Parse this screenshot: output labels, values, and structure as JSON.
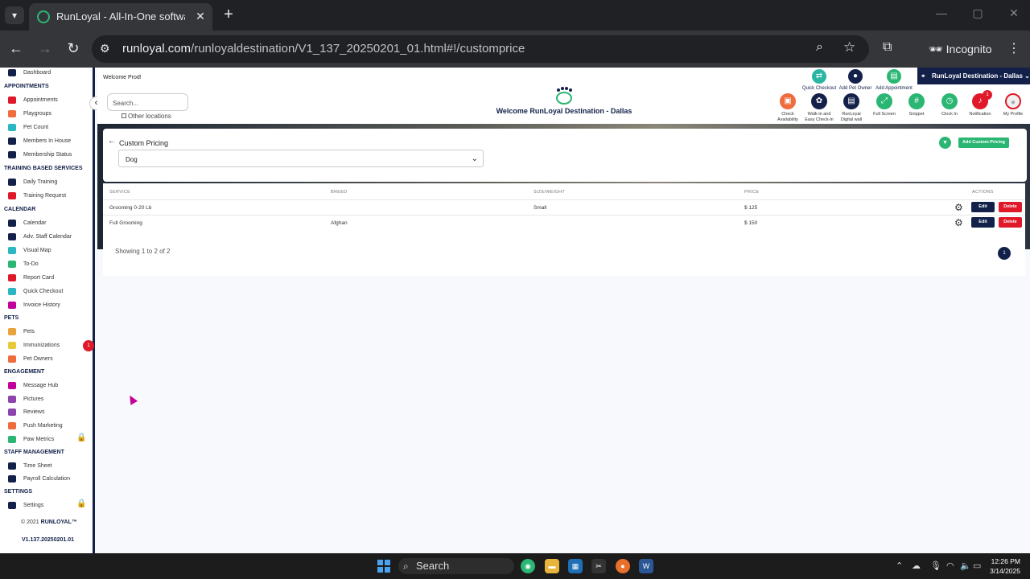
{
  "browser": {
    "tab_title": "RunLoyal - All-In-One software",
    "tab_close": "✕",
    "new_tab": "+",
    "url_host": "runloyal.com",
    "url_path": "/runloyaldestination/V1_137_20250201_01.html#!/customprice",
    "incognito_label": "Incognito"
  },
  "sidebar": {
    "top_item": "Dashboard",
    "sections": {
      "appointments": "APPOINTMENTS",
      "training": "TRAINING BASED SERVICES",
      "calendar": "CALENDAR",
      "pets": "PETS",
      "engagement": "ENGAGEMENT",
      "staff": "STAFF MANAGEMENT",
      "settings": "SETTINGS"
    },
    "items": {
      "appointments": "Appointments",
      "playgroups": "Playgroups",
      "pet_count": "Pet Count",
      "members_in_house": "Members In House",
      "membership_status": "Membership Status",
      "daily_training": "Daily Training",
      "training_request": "Training Request",
      "calendar": "Calendar",
      "adv_staff_calendar": "Adv. Staff Calendar",
      "visual_map": "Visual Map",
      "todo": "To-Do",
      "report_card": "Report Card",
      "quick_checkout": "Quick Checkout",
      "invoice_history": "Invoice History",
      "pets": "Pets",
      "immunizations": "Immunizations",
      "pet_owners": "Pet Owners",
      "message_hub": "Message Hub",
      "pictures": "Pictures",
      "reviews": "Reviews",
      "push_marketing": "Push Marketing",
      "paw_metrics": "Paw Metrics",
      "time_sheet": "Time Sheet",
      "payroll_calculation": "Payroll Calculation",
      "settings": "Settings"
    },
    "immunizations_badge": "1",
    "copyright_year": "© 2021",
    "copyright_brand": "RUNLOYAL™",
    "version": "V1.137.20250201.01"
  },
  "header": {
    "welcome_user": "Welcome Prod!",
    "search_placeholder": "Search...",
    "other_locations": "Other locations",
    "center_title": "Welcome RunLoyal Destination - Dallas",
    "quick_actions": [
      "Quick Checkout",
      "Add Pet Owner",
      "Add Appointment"
    ],
    "location": "RunLoyal Destination - Dallas",
    "toolbar": [
      {
        "label1": "Check",
        "label2": "Availability",
        "color": "#ef6c3e",
        "glyph": "▣"
      },
      {
        "label1": "Walk-in and",
        "label2": "Easy Check-in",
        "color": "#13214a",
        "glyph": "✿"
      },
      {
        "label1": "RunLoyal",
        "label2": "Digital wall",
        "color": "#13214a",
        "glyph": "▤"
      },
      {
        "label1": "Full Screen",
        "label2": "",
        "color": "#2bb673",
        "glyph": "⤢"
      },
      {
        "label1": "Snippet",
        "label2": "",
        "color": "#2bb673",
        "glyph": "#"
      },
      {
        "label1": "Clock In",
        "label2": "",
        "color": "#2bb673",
        "glyph": "◷"
      },
      {
        "label1": "Notification",
        "label2": "",
        "color": "#e0192a",
        "glyph": "♪"
      },
      {
        "label1": "My Profile",
        "label2": "",
        "color": "#f0f0f0",
        "glyph": "●"
      }
    ],
    "notification_badge": "1"
  },
  "pricing": {
    "title": "Custom Pricing",
    "pet_type": "Dog",
    "add_button": "Add Custom Pricing",
    "columns": [
      "SERVICE",
      "BREED",
      "SIZE/WEIGHT",
      "PRICE",
      "ACTIONS"
    ],
    "rows": [
      {
        "service": "Grooming 0-20 Lb",
        "breed": "",
        "size": "Small",
        "price": "$ 125"
      },
      {
        "service": "Full Grooming",
        "breed": "Afghan",
        "size": "",
        "price": "$ 150"
      }
    ],
    "edit_label": "Edit",
    "delete_label": "Delete",
    "showing": "Showing 1 to 2 of 2",
    "page": "1"
  },
  "taskbar": {
    "search": "Search",
    "time": "12:26 PM",
    "date": "3/14/2025"
  },
  "colors": {
    "navy": "#13214a",
    "green": "#2bb673",
    "red": "#e0192a"
  }
}
